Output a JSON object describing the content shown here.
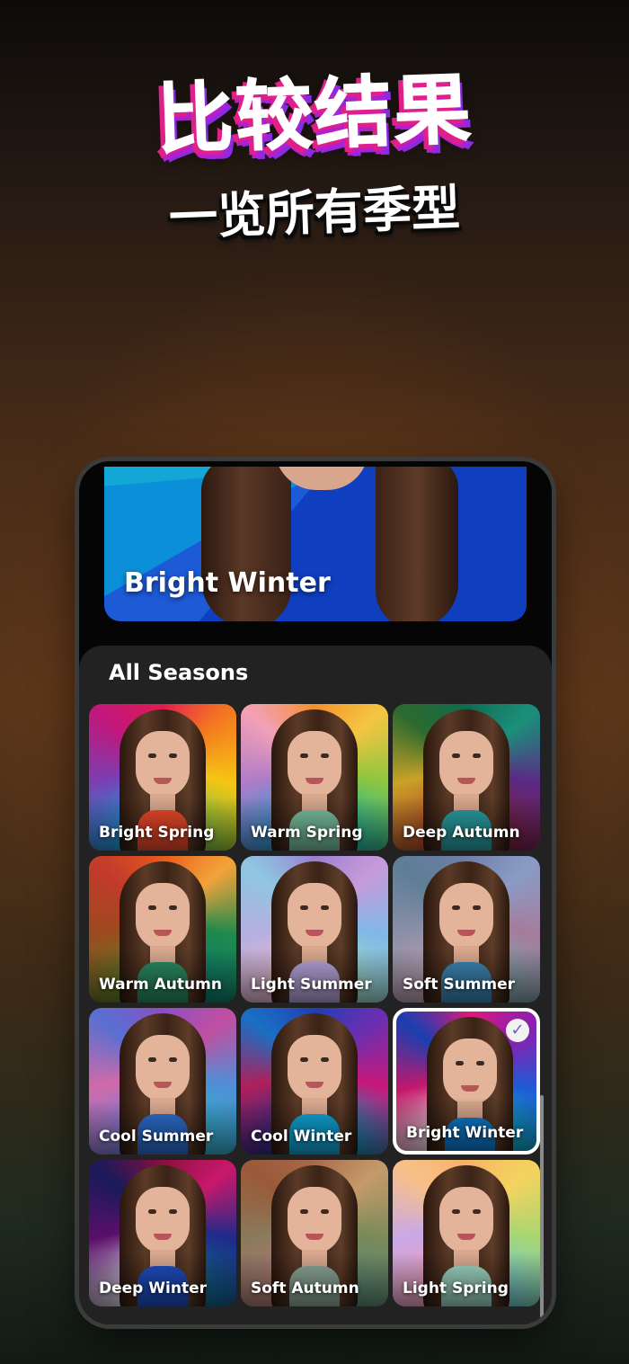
{
  "promo": {
    "headline": "比较结果",
    "subline": "一览所有季型"
  },
  "hero": {
    "label": "Bright Winter"
  },
  "sheet": {
    "title": "All Seasons"
  },
  "seasons": [
    {
      "label": "Bright Spring",
      "selected": false,
      "palette": [
        "#e31b52",
        "#f47a1f",
        "#f6c514",
        "#7bc043",
        "#1a9bd7",
        "#7a3fb3",
        "#c1177c",
        "#e31b52"
      ],
      "drape": "#f04a2b"
    },
    {
      "label": "Warm Spring",
      "selected": false,
      "palette": [
        "#f58f2a",
        "#f4c542",
        "#8cc63f",
        "#1fb5a3",
        "#2a9ad6",
        "#b07cc6",
        "#f2a0b8",
        "#f58f2a"
      ],
      "drape": "#7cc3a3"
    },
    {
      "label": "Deep Autumn",
      "selected": false,
      "palette": [
        "#0e6a4f",
        "#1b8f7a",
        "#5b2a86",
        "#7a1f3d",
        "#b0472a",
        "#c9a227",
        "#2d6a2e",
        "#0e6a4f"
      ],
      "drape": "#2aa1a6"
    },
    {
      "label": "Warm Autumn",
      "selected": false,
      "palette": [
        "#e85a1c",
        "#f2a33a",
        "#1f8a4c",
        "#0d7a6f",
        "#5a7d2a",
        "#9c4a1e",
        "#c23a2b",
        "#e85a1c"
      ],
      "drape": "#2b8c63"
    },
    {
      "label": "Light Summer",
      "selected": false,
      "palette": [
        "#9a7fd1",
        "#c79ad9",
        "#7fb8e8",
        "#9fd9c9",
        "#e7b4c9",
        "#b5b0e0",
        "#8fc6e0",
        "#9a7fd1"
      ],
      "drape": "#b7a6dc"
    },
    {
      "label": "Soft Summer",
      "selected": false,
      "palette": [
        "#6f7fa8",
        "#8a9bc4",
        "#a67b9c",
        "#7aa3a8",
        "#c0a0b0",
        "#8b8fa8",
        "#5f7d96",
        "#6f7fa8"
      ],
      "drape": "#3d86b5"
    },
    {
      "label": "Cool Summer",
      "selected": false,
      "palette": [
        "#8a4fc4",
        "#c04fa2",
        "#4f8fd6",
        "#2fb0c9",
        "#7a7fd9",
        "#d06aa8",
        "#5a6fd1",
        "#8a4fc4"
      ],
      "drape": "#2d6fd1"
    },
    {
      "label": "Cool Winter",
      "selected": false,
      "palette": [
        "#1f3fb5",
        "#6a2fb0",
        "#c8187a",
        "#0f8fb5",
        "#2a2a8a",
        "#b01f5a",
        "#1a6fc4",
        "#1f3fb5"
      ],
      "drape": "#10a6d8"
    },
    {
      "label": "Bright Winter",
      "selected": true,
      "palette": [
        "#e0187a",
        "#8a1fb0",
        "#1f5ad6",
        "#0fb0c4",
        "#f2f2f2",
        "#c4186a",
        "#1a3fb0",
        "#e0187a"
      ],
      "drape": "#0f7fd6"
    },
    {
      "label": "Deep Winter",
      "selected": false,
      "palette": [
        "#8a0f3f",
        "#c8186a",
        "#1f2a8a",
        "#0f6a8a",
        "#d8d8e0",
        "#5a0f6a",
        "#1a1a5a",
        "#8a0f3f"
      ],
      "drape": "#1f4fc4"
    },
    {
      "label": "Soft Autumn",
      "selected": false,
      "palette": [
        "#a86a4a",
        "#c49a6a",
        "#7a8a5a",
        "#5a8a7a",
        "#b07a7a",
        "#8a7a5a",
        "#9a5a3a",
        "#a86a4a"
      ],
      "drape": "#8fa89a"
    },
    {
      "label": "Light Spring",
      "selected": false,
      "palette": [
        "#f7b267",
        "#f4d35e",
        "#a8d672",
        "#6fc8d6",
        "#f2a0b8",
        "#c8a8e8",
        "#f7c08a",
        "#f7b267"
      ],
      "drape": "#9fd8c4"
    }
  ],
  "check_icon": "checkmark-icon"
}
